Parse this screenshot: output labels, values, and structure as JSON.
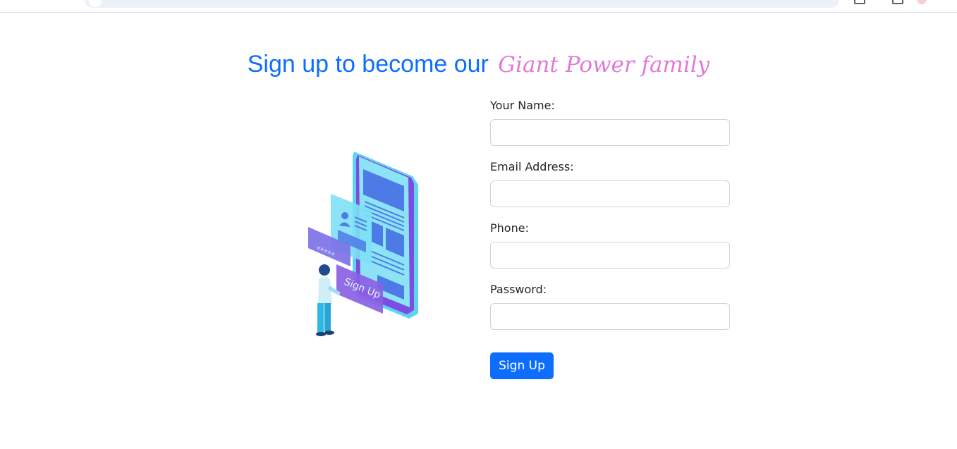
{
  "heading": {
    "main": "Sign up to become our",
    "accent": "Giant Power family"
  },
  "illustration": {
    "stars": "*****",
    "button_text": "Sign Up"
  },
  "form": {
    "name_label": "Your Name:",
    "email_label": "Email Address:",
    "phone_label": "Phone:",
    "password_label": "Password:",
    "name_value": "",
    "email_value": "",
    "phone_value": "",
    "password_value": ""
  },
  "submit_label": "Sign Up",
  "colors": {
    "primary": "#0d6efd",
    "accent": "#e079d8"
  }
}
